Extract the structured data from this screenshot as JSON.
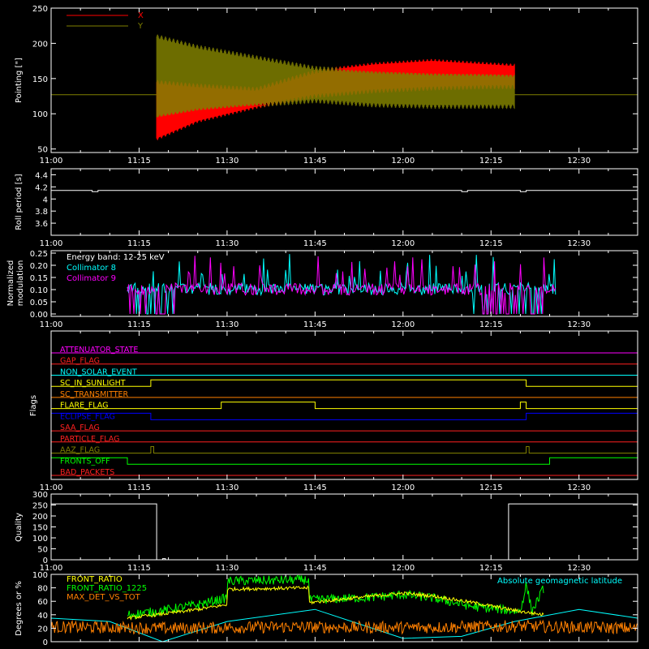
{
  "colors": {
    "background": "#000000",
    "axis": "#ffffff",
    "pointing_x": "#ff0000",
    "pointing_y": "#808000",
    "collimator_8": "#00ffff",
    "collimator_9": "#ff00ff",
    "front_ratio": "#ffff00",
    "front_ratio_1225": "#00ff00",
    "max_det": "#ff8000",
    "geomag": "#00ffff"
  },
  "time_axis": {
    "start": "11:00",
    "end": "12:40",
    "ticks": [
      "11:00",
      "11:15",
      "11:30",
      "11:45",
      "12:00",
      "12:15",
      "12:30"
    ]
  },
  "chart_data": [
    {
      "id": "pointing",
      "type": "line",
      "ylabel": "Pointing [\"]",
      "ylim": [
        45,
        250
      ],
      "yticks": [
        50,
        100,
        150,
        200,
        250
      ],
      "legend": [
        {
          "name": "X",
          "color_key": "pointing_x"
        },
        {
          "name": "Y",
          "color_key": "pointing_y"
        }
      ],
      "baseline": 127,
      "oscillation_window": [
        "11:18",
        "12:19"
      ],
      "series": [
        {
          "name": "X",
          "x": [
            "11:18",
            "11:25",
            "11:35",
            "11:45",
            "11:55",
            "12:05",
            "12:15",
            "12:19"
          ],
          "upper": [
            145,
            140,
            135,
            160,
            170,
            175,
            170,
            168
          ],
          "lower": [
            65,
            90,
            110,
            125,
            132,
            136,
            138,
            138
          ]
        },
        {
          "name": "Y",
          "x": [
            "11:18",
            "11:25",
            "11:35",
            "11:45",
            "11:55",
            "12:05",
            "12:15",
            "12:19"
          ],
          "upper": [
            210,
            195,
            180,
            165,
            160,
            157,
            156,
            155
          ],
          "lower": [
            95,
            105,
            112,
            118,
            112,
            110,
            110,
            110
          ]
        }
      ]
    },
    {
      "id": "roll",
      "type": "line",
      "ylabel": "Roll period [s]",
      "ylim": [
        3.4,
        4.5
      ],
      "yticks": [
        3.6,
        3.8,
        4.0,
        4.2,
        4.4
      ],
      "series": [
        {
          "name": "",
          "x": [
            "11:00",
            "11:07",
            "11:07",
            "11:08",
            "11:08",
            "12:10",
            "12:10",
            "12:11",
            "12:11",
            "12:20",
            "12:20",
            "12:21",
            "12:21",
            "12:40"
          ],
          "values": [
            4.14,
            4.14,
            4.12,
            4.12,
            4.14,
            4.14,
            4.12,
            4.12,
            4.14,
            4.14,
            4.12,
            4.12,
            4.14,
            4.14
          ]
        }
      ]
    },
    {
      "id": "modulation",
      "type": "line",
      "ylabel": "Normalized modulation",
      "ylim": [
        -0.01,
        0.26
      ],
      "yticks": [
        "0.00",
        "0.05",
        "0.10",
        "0.15",
        "0.20",
        "0.25"
      ],
      "annotation": "Energy band: 12-25 keV",
      "window": [
        "11:13",
        "12:26"
      ],
      "mean": 0.1,
      "series": [
        {
          "name": "Collimator 8",
          "color_key": "collimator_8"
        },
        {
          "name": "Collimator 9",
          "color_key": "collimator_9"
        }
      ]
    },
    {
      "id": "flags",
      "type": "line",
      "ylabel": "Flags",
      "series": [
        {
          "name": "ATTENUATOR_STATE",
          "color": "#ff00ff",
          "x": [
            "11:00",
            "12:40"
          ],
          "values": [
            0,
            0
          ]
        },
        {
          "name": "GAP_FLAG",
          "color": "#ff2020",
          "x": [
            "11:00",
            "12:40"
          ],
          "values": [
            0,
            0
          ]
        },
        {
          "name": "NON_SOLAR_EVENT",
          "color": "#00ffff",
          "x": [
            "11:00",
            "12:40"
          ],
          "values": [
            0,
            0
          ]
        },
        {
          "name": "SC_IN_SUNLIGHT",
          "color": "#ffff00",
          "x": [
            "11:00",
            "11:17",
            "11:17",
            "12:21",
            "12:21",
            "12:40"
          ],
          "values": [
            0,
            0,
            1,
            1,
            0,
            0
          ]
        },
        {
          "name": "SC_TRANSMITTER",
          "color": "#ff8000",
          "x": [
            "11:00",
            "12:40"
          ],
          "values": [
            0,
            0
          ]
        },
        {
          "name": "FLARE_FLAG",
          "color": "#ffff00",
          "x": [
            "11:00",
            "11:29",
            "11:29",
            "11:45",
            "11:45",
            "12:20",
            "12:20",
            "12:21",
            "12:21",
            "12:40"
          ],
          "values": [
            0,
            0,
            1,
            1,
            0,
            0,
            1,
            1,
            0,
            0
          ]
        },
        {
          "name": "ECLIPSE_FLAG",
          "color": "#0000ff",
          "x": [
            "11:00",
            "11:17",
            "11:17",
            "12:21",
            "12:21",
            "12:40"
          ],
          "values": [
            1,
            1,
            0,
            0,
            1,
            1
          ]
        },
        {
          "name": "SAA_FLAG",
          "color": "#ff2020",
          "x": [
            "11:00",
            "12:40"
          ],
          "values": [
            0,
            0
          ]
        },
        {
          "name": "PARTICLE_FLAG",
          "color": "#ff2020",
          "x": [
            "11:00",
            "12:40"
          ],
          "values": [
            0,
            0
          ]
        },
        {
          "name": "AAZ_FLAG",
          "color": "#808000",
          "x": [
            "11:00",
            "11:17",
            "11:17",
            "11:17.5",
            "11:17.5",
            "12:21",
            "12:21",
            "12:21.5",
            "12:21.5",
            "12:40"
          ],
          "values": [
            0,
            0,
            1,
            1,
            0,
            0,
            1,
            1,
            0,
            0
          ]
        },
        {
          "name": "FRONTS_OFF",
          "color": "#00ff00",
          "x": [
            "11:00",
            "11:13",
            "11:13",
            "12:25",
            "12:25",
            "12:40"
          ],
          "values": [
            1,
            1,
            0,
            0,
            1,
            1
          ]
        },
        {
          "name": "BAD_PACKETS",
          "color": "#ff2020",
          "x": [
            "11:00",
            "12:40"
          ],
          "values": [
            0,
            0
          ]
        }
      ]
    },
    {
      "id": "quality",
      "type": "line",
      "ylabel": "Quality",
      "ylim": [
        0,
        300
      ],
      "yticks": [
        0,
        50,
        100,
        150,
        200,
        250,
        300
      ],
      "series": [
        {
          "name": "",
          "x": [
            "11:00",
            "11:18",
            "11:18",
            "11:19",
            "11:19",
            "11:19.5",
            "11:19.5",
            "12:18",
            "12:18",
            "12:40"
          ],
          "values": [
            255,
            255,
            0,
            0,
            5,
            5,
            0,
            0,
            255,
            255
          ]
        }
      ]
    },
    {
      "id": "ratios",
      "type": "line",
      "ylabel": "Degrees or %",
      "ylim": [
        0,
        100
      ],
      "yticks": [
        0,
        20,
        40,
        60,
        80,
        100
      ],
      "annotation": "Absolute geomagnetic latitude",
      "series": [
        {
          "name": "FRONT_RATIO",
          "color_key": "front_ratio",
          "x": [
            "11:13",
            "11:18",
            "11:25",
            "11:30",
            "11:30",
            "11:44",
            "11:44",
            "11:55",
            "12:00",
            "12:05",
            "12:12",
            "12:20",
            "12:24"
          ],
          "values": [
            35,
            40,
            48,
            55,
            78,
            80,
            58,
            68,
            72,
            68,
            58,
            45,
            40
          ]
        },
        {
          "name": "FRONT_RATIO_1225",
          "color_key": "front_ratio_1225",
          "x": [
            "11:13",
            "11:18",
            "11:25",
            "11:30",
            "11:30",
            "11:44",
            "11:44",
            "11:55",
            "12:00",
            "12:05",
            "12:12",
            "12:20",
            "12:21",
            "12:22",
            "12:24"
          ],
          "values": [
            40,
            45,
            55,
            65,
            90,
            92,
            62,
            66,
            70,
            65,
            52,
            45,
            85,
            45,
            80
          ]
        },
        {
          "name": "MAX_DET_VS_TOT",
          "color_key": "max_det",
          "x": [
            "11:00",
            "11:20",
            "11:40",
            "12:00",
            "12:20",
            "12:40"
          ],
          "values": [
            22,
            20,
            22,
            21,
            23,
            20
          ]
        },
        {
          "name": "Absolute geomagnetic latitude",
          "color_key": "geomag",
          "x": [
            "11:00",
            "11:10",
            "11:19",
            "11:30",
            "11:45",
            "12:00",
            "12:10",
            "12:19",
            "12:30",
            "12:40"
          ],
          "values": [
            35,
            30,
            0,
            30,
            48,
            5,
            8,
            30,
            48,
            35
          ]
        }
      ]
    }
  ]
}
